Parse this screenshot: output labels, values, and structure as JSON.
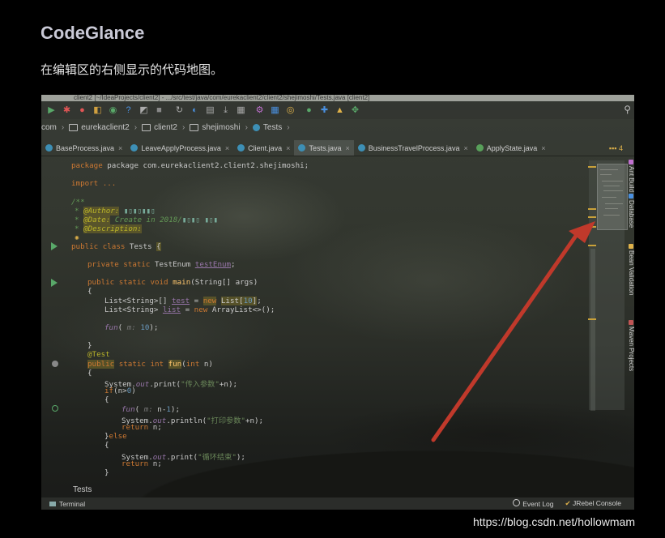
{
  "header": {
    "title": "CodeGlance",
    "description": "在编辑区的右侧显示的代码地图。"
  },
  "window": {
    "title": "client2 [~/IdeaProjects/client2] - .../src/test/java/com/eurekaclient2/client2/shejimoshi/Tests.java [client2]"
  },
  "breadcrumb": {
    "items": [
      "com",
      "eurekaclient2",
      "client2",
      "shejimoshi",
      "Tests"
    ]
  },
  "tabs": [
    {
      "label": "BaseProcess.java",
      "active": false
    },
    {
      "label": "LeaveApplyProcess.java",
      "active": false
    },
    {
      "label": "Client.java",
      "active": false
    },
    {
      "label": "Tests.java",
      "active": true
    },
    {
      "label": "BusinessTravelProcess.java",
      "active": false
    },
    {
      "label": "ApplyState.java",
      "active": false
    }
  ],
  "tabs_overflow": "4",
  "code": {
    "package": "package com.eurekaclient2.client2.shejimoshi;",
    "import": "import ...",
    "doc_open": "/**",
    "author_tag": "@Author:",
    "date_tag": "@Date:",
    "date_text": "Create in 2018/",
    "desc_tag": "@Description:",
    "class_decl": "public class Tests {",
    "field": "private static TestEnum testEnum;",
    "main_decl": "public static void main(String[] args)",
    "brace_open": "{",
    "brace_close": "}",
    "list_line1": "List<String>[] test = new List[10];",
    "list_line2": "List<String> list = new ArrayList<>();",
    "fun_call": "fun( m: 10);",
    "test_annot": "@Test",
    "fun_decl": "public static int fun(int n)",
    "print1": "System.out.print(\"传入参数\"+n);",
    "if_line": "if(n>0)",
    "fun_rec": "fun( m: n-1);",
    "println": "System.out.println(\"打印参数\"+n);",
    "return_n": "return n;",
    "else": "}else",
    "print2": "System.out.print(\"循环结束\");",
    "return_n2": "return n;"
  },
  "right_tools": [
    "Ant Build",
    "Database",
    "Bean Validation",
    "Maven Projects"
  ],
  "bottom_tool_tab": "Tests",
  "status": {
    "terminal": "Terminal",
    "event_log": "Event Log",
    "jrebel": "JRebel Console"
  },
  "watermark": "https://blog.csdn.net/hollowmam",
  "colors": {
    "arrow": "#c0392b",
    "keyword": "#cc7832",
    "string": "#6a8759",
    "annotation": "#bbb529",
    "comment": "#629755"
  }
}
